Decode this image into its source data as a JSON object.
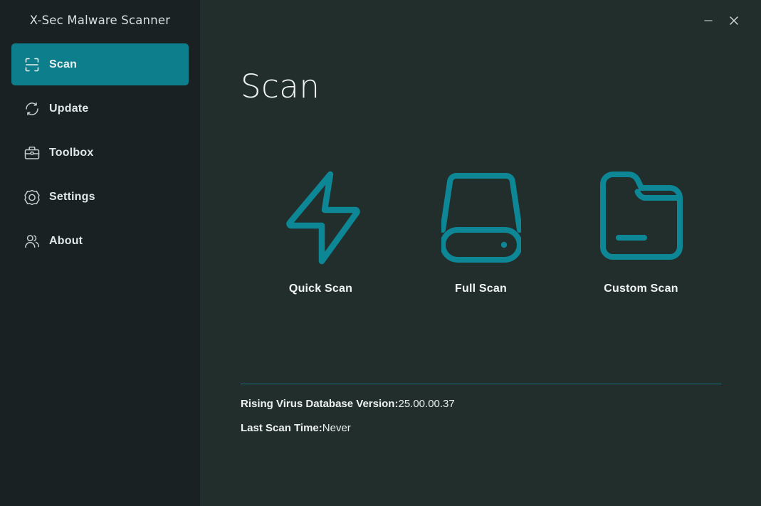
{
  "app": {
    "title": "X-Sec Malware Scanner"
  },
  "window_controls": {
    "minimize": "minimize-icon",
    "close": "close-icon"
  },
  "colors": {
    "accent": "#0d7f8c",
    "sidebar_bg": "#1a2123",
    "content_bg": "#222e2c",
    "divider": "#17707c",
    "icon_stroke": "#0d8795",
    "text_primary": "#eef3f2",
    "nav_icon": "#c4cecd"
  },
  "sidebar": {
    "items": [
      {
        "label": "Scan",
        "icon": "scan-frame-icon",
        "active": true
      },
      {
        "label": "Update",
        "icon": "refresh-icon",
        "active": false
      },
      {
        "label": "Toolbox",
        "icon": "toolbox-icon",
        "active": false
      },
      {
        "label": "Settings",
        "icon": "gear-icon",
        "active": false
      },
      {
        "label": "About",
        "icon": "people-icon",
        "active": false
      }
    ]
  },
  "main": {
    "page_title": "Scan",
    "scan_options": [
      {
        "label": "Quick Scan",
        "icon": "lightning-bolt-icon"
      },
      {
        "label": "Full Scan",
        "icon": "hard-drive-icon"
      },
      {
        "label": "Custom Scan",
        "icon": "folder-icon"
      }
    ],
    "info": [
      {
        "key": "Rising Virus Database Version:",
        "value": "25.00.00.37"
      },
      {
        "key": "Last Scan Time:",
        "value": "Never"
      }
    ]
  }
}
